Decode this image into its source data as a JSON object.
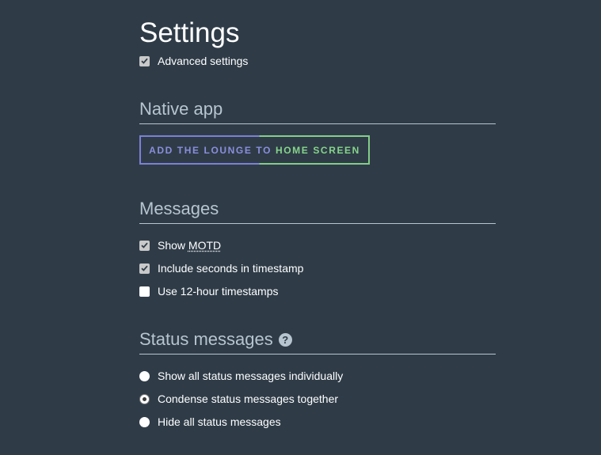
{
  "page": {
    "title": "Settings"
  },
  "advanced": {
    "label": "Advanced settings",
    "checked": true
  },
  "native_app": {
    "heading": "Native app",
    "button_part1": "Add The Lounge to",
    "button_part2": "home screen"
  },
  "messages": {
    "heading": "Messages",
    "items": [
      {
        "label_prefix": "Show ",
        "label_abbr": "MOTD",
        "checked": true
      },
      {
        "label": "Include seconds in timestamp",
        "checked": true
      },
      {
        "label": "Use 12-hour timestamps",
        "checked": false
      }
    ]
  },
  "status_messages": {
    "heading": "Status messages",
    "help_glyph": "?",
    "options": [
      {
        "label": "Show all status messages individually",
        "selected": false
      },
      {
        "label": "Condense status messages together",
        "selected": true
      },
      {
        "label": "Hide all status messages",
        "selected": false
      }
    ]
  },
  "colors": {
    "background": "#2f3c48",
    "heading": "#b7c5d1",
    "button_left": "#8a8edc",
    "button_right": "#86d48a"
  }
}
